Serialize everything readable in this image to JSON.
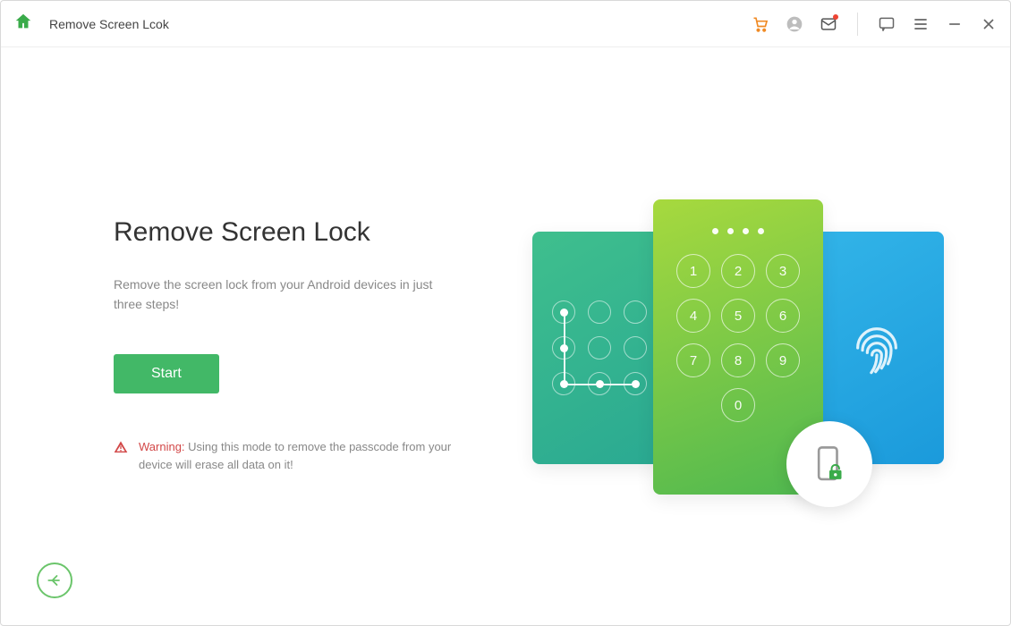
{
  "header": {
    "title": "Remove Screen Lcok"
  },
  "main": {
    "heading": "Remove Screen Lock",
    "description": "Remove the screen lock from your Android devices in just three steps!",
    "start_label": "Start",
    "warning_label": "Warning:",
    "warning_text": " Using this mode to remove the passcode from your device will erase all data on it!"
  },
  "keypad": {
    "dots_count": 4,
    "keys": [
      "1",
      "2",
      "3",
      "4",
      "5",
      "6",
      "7",
      "8",
      "9",
      "0"
    ]
  },
  "colors": {
    "accent_green": "#42b867",
    "warning_red": "#d24747",
    "cart_orange": "#f08a24"
  }
}
